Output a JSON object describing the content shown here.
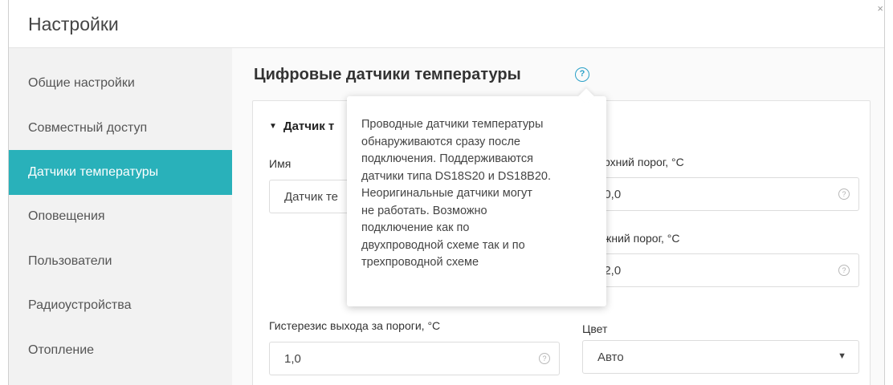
{
  "header": {
    "title": "Настройки",
    "close_glyph": "×"
  },
  "sidebar": {
    "items": [
      {
        "label": "Общие настройки",
        "active": false
      },
      {
        "label": "Совместный доступ",
        "active": false
      },
      {
        "label": "Датчики температуры",
        "active": true
      },
      {
        "label": "Оповещения",
        "active": false
      },
      {
        "label": "Пользователи",
        "active": false
      },
      {
        "label": "Радиоустройства",
        "active": false
      },
      {
        "label": "Отопление",
        "active": false
      }
    ]
  },
  "main": {
    "title": "Цифровые датчики температуры",
    "help_glyph": "?",
    "sensor": {
      "header_label": "Датчик т",
      "name_label": "Имя",
      "name_value": "Датчик те",
      "upper_label": "рхний порог, °С",
      "upper_value": "40,0",
      "lower_label": "жний порог, °С",
      "lower_value": "22,0",
      "hysteresis_label": "Гистерезис выхода за пороги, °С",
      "hysteresis_value": "1,0",
      "color_label": "Цвет",
      "color_value": "Авто"
    }
  },
  "tooltip": {
    "lines": [
      "Проводные датчики температуры",
      "обнаруживаются сразу после",
      "подключения. Поддерживаются",
      "датчики типа DS18S20 и DS18B20.",
      "Неоригинальные датчики могут",
      "не работать. Возможно",
      "подключение как по",
      "двухпроводной схеме так и по",
      "трехпроводной схеме"
    ]
  },
  "colors": {
    "accent": "#29b1ba",
    "help": "#29a0c8"
  }
}
